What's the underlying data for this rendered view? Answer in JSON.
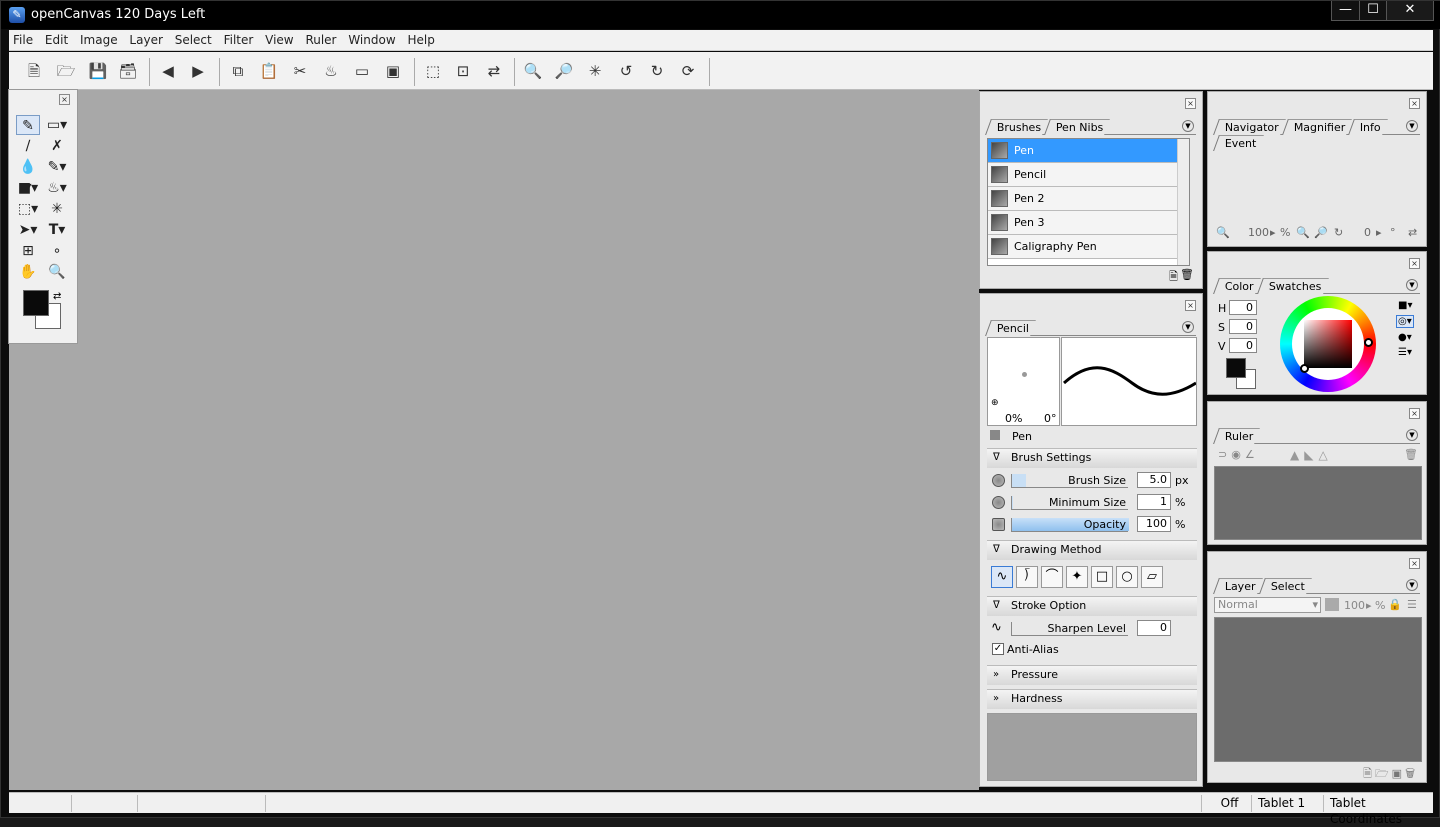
{
  "window": {
    "title": "openCanvas 120 Days Left",
    "app_icon": "&",
    "minimize": "—",
    "maximize": "☐",
    "close": "✕"
  },
  "menu": [
    "File",
    "Edit",
    "Image",
    "Layer",
    "Select",
    "Filter",
    "View",
    "Ruler",
    "Window",
    "Help"
  ],
  "toolbar_icons": [
    "new-file-icon",
    "open-folder-icon",
    "save-icon",
    "save-as-icon",
    "prev-icon",
    "next-icon",
    "copy-icon",
    "paste-icon",
    "cut-icon",
    "fill-icon",
    "eraser-icon",
    "transform-icon",
    "select-rect-icon",
    "deselect-icon",
    "invert-select-icon",
    "zoom-in-icon",
    "zoom-out-icon",
    "zoom-reset-icon",
    "undo-icon",
    "redo-icon",
    "repeat-icon"
  ],
  "toolbox": {
    "tools": [
      "pen",
      "eraser",
      "brush",
      "airbrush",
      "water",
      "blur",
      "gradient",
      "bucket",
      "marquee",
      "magic-wand",
      "move",
      "text",
      "crop",
      "eyedropper",
      "hand",
      "zoom"
    ],
    "fg_color": "#0a0a0a",
    "bg_color": "#ffffff"
  },
  "brushes_panel": {
    "tabs": [
      "Brushes",
      "Pen Nibs"
    ],
    "items": [
      {
        "name": "Pen",
        "selected": true
      },
      {
        "name": "Pencil",
        "selected": false
      },
      {
        "name": "Pen 2",
        "selected": false
      },
      {
        "name": "Pen 3",
        "selected": false
      },
      {
        "name": "Caligraphy Pen",
        "selected": false
      }
    ]
  },
  "pencil_panel": {
    "tab": "Pencil",
    "preview_pct": "0%",
    "preview_deg": "0°",
    "brush_type": "Pen",
    "brush_settings": "Brush Settings",
    "brush_size_label": "Brush Size",
    "brush_size": "5.0",
    "brush_size_unit": "px",
    "min_size_label": "Minimum Size",
    "min_size": "1",
    "min_size_unit": "%",
    "opacity_label": "Opacity",
    "opacity": "100",
    "opacity_unit": "%",
    "drawing_method": "Drawing Method",
    "stroke_option": "Stroke Option",
    "sharpen_label": "Sharpen Level",
    "sharpen": "0",
    "anti_alias": "Anti-Alias",
    "pressure": "Pressure",
    "hardness": "Hardness"
  },
  "navigator_panel": {
    "tabs": [
      "Navigator",
      "Magnifier",
      "Info",
      "Event"
    ],
    "zoom": "100",
    "zoom_unit": "%",
    "angle": "0",
    "angle_unit": "°"
  },
  "color_panel": {
    "tabs": [
      "Color",
      "Swatches"
    ],
    "h_label": "H",
    "h": "0",
    "s_label": "S",
    "s": "0",
    "v_label": "V",
    "v": "0",
    "fg_color": "#0a0a0a"
  },
  "ruler_panel": {
    "tabs": [
      "Ruler"
    ]
  },
  "layer_panel": {
    "tabs": [
      "Layer",
      "Select"
    ],
    "blend_mode": "Normal",
    "opacity": "100",
    "opacity_unit": "%"
  },
  "status": {
    "off": "Off",
    "tablet": "Tablet 1",
    "coords": "Tablet Coordinates"
  }
}
